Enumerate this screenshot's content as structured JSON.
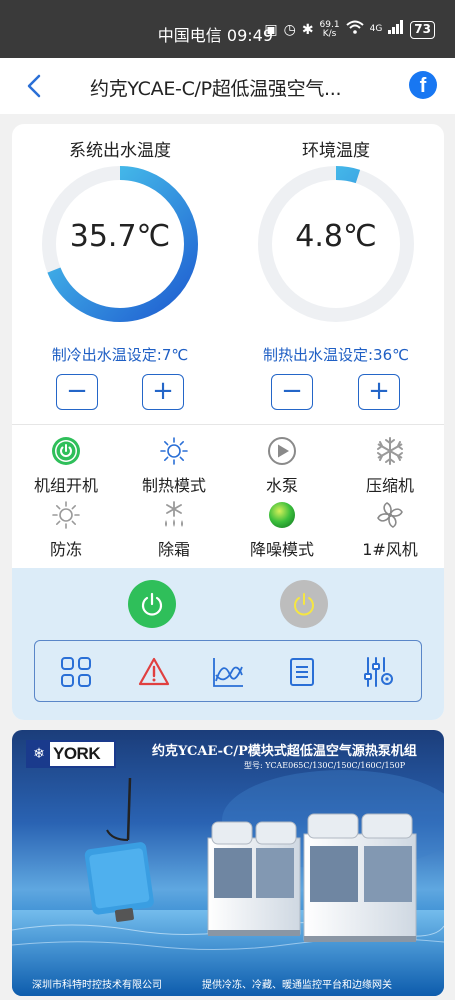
{
  "status_bar": {
    "text": "中国电信 09:49",
    "net_speed": "69.1",
    "net_unit": "K/s",
    "signal": "4G",
    "battery": "73"
  },
  "header": {
    "title": "约克YCAE-C/P超低温强空气...",
    "share_label": "f"
  },
  "gauges": [
    {
      "label": "系统出水温度",
      "value": "35.7℃",
      "fill": 0.69,
      "setpoint": "制冷出水温设定:7℃"
    },
    {
      "label": "环境温度",
      "value": "4.8℃",
      "fill": 0.05,
      "setpoint": "制热出水温设定:36℃"
    }
  ],
  "buttons": {
    "minus": "−",
    "plus": "+"
  },
  "status_items": [
    {
      "label": "机组开机",
      "icon": "power-on-icon"
    },
    {
      "label": "制热模式",
      "icon": "sun-icon"
    },
    {
      "label": "水泵",
      "icon": "play-icon"
    },
    {
      "label": "压缩机",
      "icon": "snowflake-icon"
    },
    {
      "label": "防冻",
      "icon": "sun-outline-icon"
    },
    {
      "label": "除霜",
      "icon": "defrost-icon"
    },
    {
      "label": "降噪模式",
      "icon": "green-dot-icon"
    },
    {
      "label": "1#风机",
      "icon": "fan-icon"
    }
  ],
  "colors": {
    "accent": "#2466c8",
    "gauge_track": "#eef0f3",
    "power_on": "#2fbf5a",
    "power_off": "#bdbdbd",
    "alarm": "#e04040"
  },
  "banner": {
    "logo": "YORK",
    "title": "约克YCAE-C/P模块式超低温空气源热泵机组",
    "model": "型号: YCAE065C/130C/150C/160C/150P",
    "footer_left": "深圳市科特时控技术有限公司",
    "footer_right": "提供冷冻、冷藏、暖通监控平台和边缘网关"
  }
}
